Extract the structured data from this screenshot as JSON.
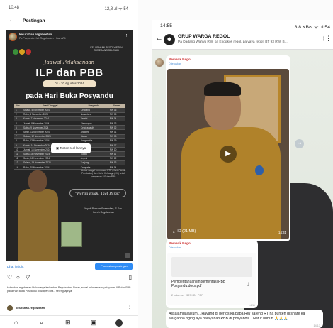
{
  "left": {
    "status": {
      "time": "10:48",
      "right": "12,8 .ıl ᯤ 54"
    },
    "header": {
      "back": "←",
      "title": "Postingan"
    },
    "account": {
      "name": "kelurahan.regolwetan",
      "sub": "Pa Posyandu Kel. Regolwetan · Hari AP1"
    },
    "org": "KELURAHAN REGOLWETAN SUMEDANG SELATAN",
    "schedule_label": "Jadwal Pelaksanaan",
    "big_title": "ILP dan PBB",
    "date_range": "01 - 30 Agustus 2024",
    "subtitle": "pada Hari Buka Posyandu",
    "table": {
      "headers": [
        "No",
        "Hari/ Tanggal",
        "Posyandu",
        "Alamat"
      ],
      "rows": [
        [
          "1",
          "Selasa, 5 November 2024",
          "Cendana",
          "RW 06"
        ],
        [
          "2",
          "Rabu, 6 November 2024",
          "Nusantara",
          "RW 05"
        ],
        [
          "3",
          "Kamis, 7 November 2024",
          "Teratai",
          "RW 04"
        ],
        [
          "4",
          "Jum'at, 8 November 2024",
          "Flamboyan",
          "RW 03"
        ],
        [
          "5",
          "Sabtu, 9 November 2024",
          "Cendrawasih",
          "RW 02"
        ],
        [
          "6",
          "Senin, 11 November 2024",
          "Anggrek",
          "RW 01"
        ],
        [
          "7",
          "Selasa, 12 November 2024",
          "Mawar",
          "RW 08"
        ],
        [
          "8",
          "Rabu, 13 November 2024",
          "Bougenville",
          "RW 09"
        ],
        [
          "9",
          "Kamis, 14 November 2024",
          "Melati",
          "RW 07"
        ],
        [
          "10",
          "Jum'at, 15 November 2024",
          "Kenanga",
          "RW 10"
        ],
        [
          "11",
          "Sabtu, 16 November 2024",
          "Dahlia",
          "RW 11"
        ],
        [
          "12",
          "Senin, 18 November 2024",
          "Anyelir",
          "RW 12"
        ],
        [
          "13",
          "Selasa, 19 November 2024",
          "Tunjung",
          "RW 13"
        ],
        [
          "14",
          "Rabu, 20 November 2024",
          "Cempaka",
          "RW 14"
        ]
      ]
    },
    "toast": "▣ Tonton reel lainnya",
    "note": "Untuk sanget membawa KTP (Kartu Tanda Penduduk) dan Kartu Keluarga (KK) untuk pelayanan ILP dan PBB",
    "tagline": "\"Warga Bijak, Taat Pajak\"",
    "signature": "Yoyok Purnam Rosandian, S.Sos. Lurah Regolwetan",
    "insight": "Lihat insight",
    "promote": "Promosikan postingan",
    "caption": "kelurahan.regolwetan Halo warga Kelurahan Regolwetan! Simak jadwal pelaksanaan pelayanan ILP dan PBB pada Hari Buka Posyandu di wilayah kita... selengkapnya",
    "comment_account": "kelurahan.regolwetan",
    "nav_icons": [
      "home-icon",
      "search-icon",
      "add-icon",
      "reels-icon",
      "profile-icon"
    ]
  },
  "right": {
    "status": {
      "time": "14:55",
      "right": "8,8 KB/s ᯤ .ıl 54"
    },
    "header": {
      "back": "←",
      "name": "GRUP WARGA REGOL",
      "sub": "Pa Dadang Wahyu RW, pa Enggkos regol, pa yaya regol, BT 93 RW, B..."
    },
    "msg1": {
      "sender": "Remenk Regol",
      "forwarded": "Diteruskan",
      "hd": "HD (21 MB)",
      "duration": "14:31"
    },
    "msg2": {
      "sender": "Remenk Regol",
      "forwarded": "Diteruskan",
      "doc_title": "Pemberitahuan implementasi PBB Posyandu.docx.pdf",
      "doc_size": "2 halaman · 387 KB · PDF",
      "time": "14:11"
    },
    "msg3": {
      "text": "Assalamualaikum... Hayang di bertos ka bapa RW sareng RT na punten di share ka warganna nging aya palayanan PBB di posyandu... Hatur nuhun 🙏🙏🙏",
      "time": "14:13"
    }
  }
}
